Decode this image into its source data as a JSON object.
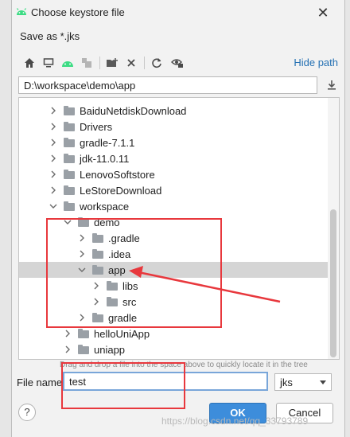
{
  "dialog": {
    "title": "Choose keystore file",
    "subtitle": "Save as *.jks"
  },
  "toolbar": {
    "icons": [
      "home-icon",
      "desktop-icon",
      "android-project-icon",
      "module-icon",
      "new-folder-icon",
      "delete-icon",
      "refresh-icon",
      "show-hidden-icon"
    ],
    "hide_path_label": "Hide path"
  },
  "path": {
    "value": "D:\\workspace\\demo\\app"
  },
  "tree": {
    "rows": [
      {
        "label": "BaiduNetdiskDownload",
        "expanded": false
      },
      {
        "label": "Drivers",
        "expanded": false
      },
      {
        "label": "gradle-7.1.1",
        "expanded": false
      },
      {
        "label": "jdk-11.0.11",
        "expanded": false
      },
      {
        "label": "LenovoSoftstore",
        "expanded": false
      },
      {
        "label": "LeStoreDownload",
        "expanded": false
      },
      {
        "label": "workspace",
        "expanded": true
      },
      {
        "label": "demo",
        "expanded": true
      },
      {
        "label": ".gradle",
        "expanded": false
      },
      {
        "label": ".idea",
        "expanded": false
      },
      {
        "label": "app",
        "expanded": true,
        "selected": true
      },
      {
        "label": "libs",
        "expanded": false
      },
      {
        "label": "src",
        "expanded": false
      },
      {
        "label": "gradle",
        "expanded": false
      },
      {
        "label": "helloUniApp",
        "expanded": false
      },
      {
        "label": "uniapp",
        "expanded": false
      }
    ]
  },
  "hint": "Drag and drop a file into the space above to quickly locate it in the tree",
  "file_name": {
    "label": "File name:",
    "value": "test",
    "extension": "jks"
  },
  "buttons": {
    "help": "?",
    "ok": "OK",
    "cancel": "Cancel"
  },
  "watermark": "https://blog.csdn.net/qq_33793789",
  "colors": {
    "accent": "#3d8ddb",
    "link": "#2470b3",
    "annotation_red": "#e8383d",
    "android_green": "#3ddc84"
  }
}
